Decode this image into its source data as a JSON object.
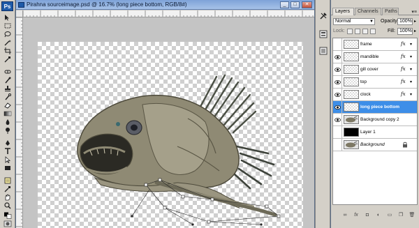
{
  "app": {
    "logo": "Ps"
  },
  "document": {
    "title": "Pirahna sourceimage.psd @ 16.7% (long piece bottom, RGB/8#)",
    "window_buttons": {
      "minimize": "_",
      "maximize": "□",
      "close": "✕"
    }
  },
  "tools": [
    "move-tool-icon",
    "marquee-tool-icon",
    "lasso-tool-icon",
    "magic-wand-tool-icon",
    "crop-tool-icon",
    "eyedropper-tool-icon",
    "healing-brush-tool-icon",
    "brush-tool-icon",
    "clone-stamp-tool-icon",
    "history-brush-tool-icon",
    "eraser-tool-icon",
    "gradient-tool-icon",
    "blur-tool-icon",
    "dodge-tool-icon",
    "pen-tool-icon",
    "type-tool-icon",
    "path-selection-tool-icon",
    "shape-tool-icon",
    "notes-tool-icon",
    "hand-tool-icon",
    "zoom-tool-icon",
    "color-swatches-icon",
    "quick-mask-icon",
    "screen-mode-icon"
  ],
  "panel": {
    "tabs": [
      "Layers",
      "Channels",
      "Paths"
    ],
    "active_tab": "Layers",
    "blend_mode": "Normal",
    "opacity_label": "Opacity:",
    "opacity": "100%",
    "lock_label": "Lock:",
    "fill_label": "Fill:",
    "fill": "100%"
  },
  "layers": [
    {
      "name": "frame",
      "visible": false,
      "thumb": "transparent",
      "fx": "fx",
      "selected": false
    },
    {
      "name": "mandible",
      "visible": true,
      "thumb": "transparent",
      "fx": "fx",
      "selected": false
    },
    {
      "name": "gill cover",
      "visible": true,
      "thumb": "transparent",
      "fx": "fx",
      "selected": false
    },
    {
      "name": "top",
      "visible": true,
      "thumb": "transparent",
      "fx": "fx",
      "selected": false
    },
    {
      "name": "clock",
      "visible": true,
      "thumb": "transparent",
      "fx": "fx",
      "selected": false
    },
    {
      "name": "long piece bottom",
      "visible": true,
      "thumb": "transparent",
      "fx": "",
      "selected": true
    },
    {
      "name": "Background copy 2",
      "visible": true,
      "thumb": "fish",
      "fx": "",
      "selected": false
    },
    {
      "name": "Layer 1",
      "visible": false,
      "thumb": "black",
      "fx": "",
      "selected": false
    },
    {
      "name": "Background",
      "visible": false,
      "thumb": "fish",
      "fx": "",
      "selected": false,
      "locked": true
    }
  ],
  "colors": {
    "selection": "#3d8ee8",
    "chrome": "#d4d0c8",
    "titlebar": "#7ea3d8"
  }
}
